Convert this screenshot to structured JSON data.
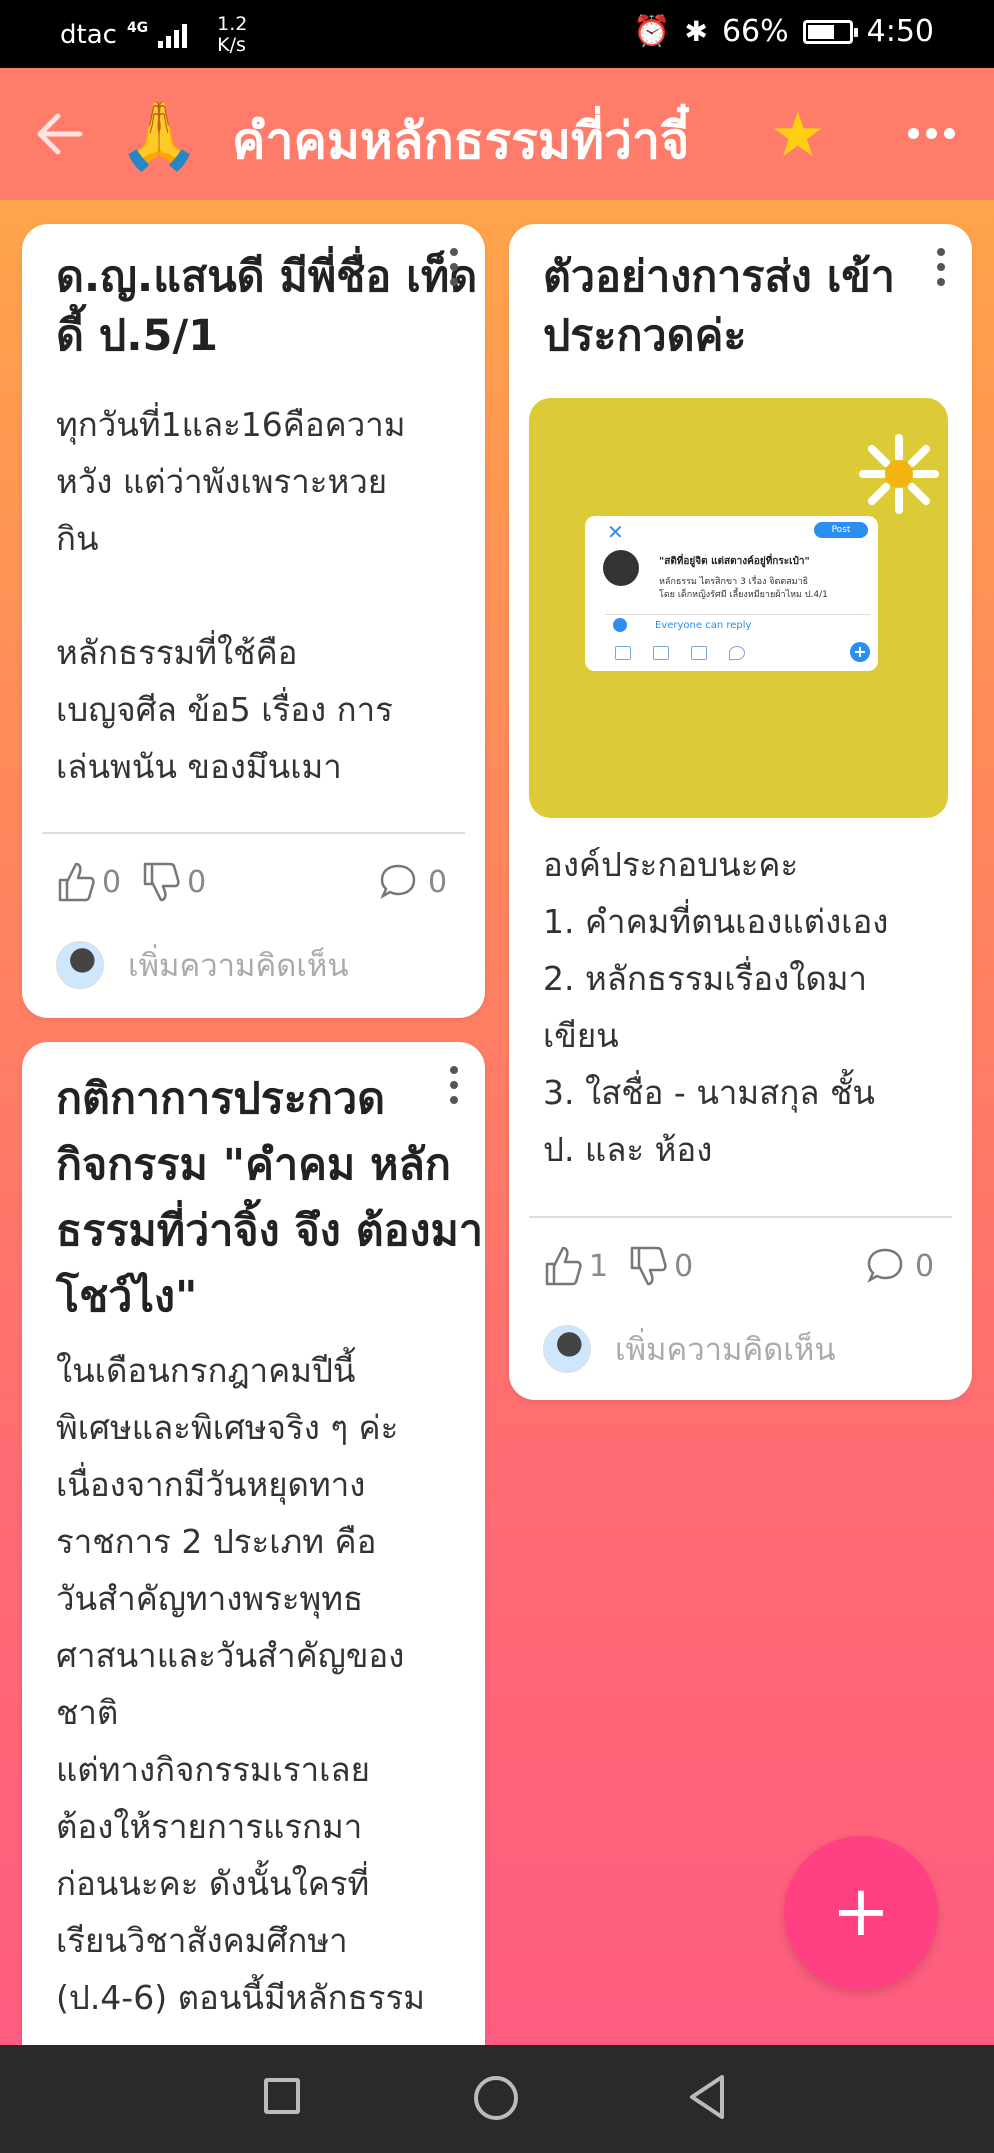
{
  "status_bar": {
    "carrier": "dtac",
    "network": "4G",
    "speed_value": "1.2",
    "speed_unit": "K/s",
    "battery": "66%",
    "battery_level": 0.66,
    "time": "4:50"
  },
  "app_bar": {
    "emoji": "🙏",
    "title": "คำคมหลักธรรมที่ว่าจี๋",
    "star": "★"
  },
  "cards": [
    {
      "title": "ด.ญ.แสนดี มีพี่ชื่อ\nเท็ดดี้ ป.5/1",
      "body": "ทุกวันที่1และ16คือความ\nหวัง แต่ว่าพังเพราะหวย\nกิน\n\nหลักธรรมที่ใช้คือ\nเบญจศีล ข้อ5 เรื่อง การ\nเล่นพนัน ของมึนเมา",
      "likes": "0",
      "dislikes": "0",
      "comments": "0",
      "add_comment": "เพิ่มความคิดเห็น"
    },
    {
      "title": "กติกาการประกวด\nกิจกรรม \"คำคม\nหลักธรรมที่ว่าจิ้ง จึง\nต้องมาโชว์ไง\"",
      "body": "ในเดือนกรกฎาคมปีนี้\nพิเศษและพิเศษจริง ๆ ค่ะ\nเนื่องจากมีวันหยุดทาง\nราชการ 2 ประเภท คือ\nวันสำคัญทางพระพุทธ\nศาสนาและวันสำคัญของ\nชาติ\nแต่ทางกิจกรรมเราเลย\nต้องให้รายการแรกมา\nก่อนนะคะ ดังนั้นใครที่\nเรียนวิชาสังคมศึกษา\n(ป.4-6) ตอนนี้มีหลักธรรม"
    },
    {
      "title": "ตัวอย่างการส่ง\nเข้าประกวดค่ะ",
      "image": {
        "post_button": "Post",
        "quote": "\"สติที่อยู่จิต แต่สตางค์อยู่ที่กระเป๋า\"",
        "line2": "หลักธรรม ไตรสิกขา 3 เรื่อง จิตตสมาธิ\nโดย เด็กหญิงรัศมี เลี้ยงหมียายผ้าไหม ป.4/1",
        "reply": "Everyone can reply"
      },
      "body": "องค์ประกอบนะคะ\n1. คำคมที่ตนเองแต่งเอง\n2. หลักธรรมเรื่องใดมา\nเขียน\n3. ใสชื่อ - นามสกุล ชั้น\nป. และ ห้อง",
      "likes": "1",
      "dislikes": "0",
      "comments": "0",
      "add_comment": "เพิ่มความคิดเห็น"
    }
  ],
  "fab": "+",
  "icons": {
    "back": "arrow-left-icon",
    "like": "thumbs-up-icon",
    "dislike": "thumbs-down-icon",
    "comment": "comment-bubble-icon",
    "more": "more-dots-icon"
  },
  "colors": {
    "app_bar": "#ff7b6a",
    "star": "#ffcf12",
    "fab": "#ff4082",
    "image_bg": "#dccb36",
    "twitter_blue": "#2b8ef0"
  }
}
